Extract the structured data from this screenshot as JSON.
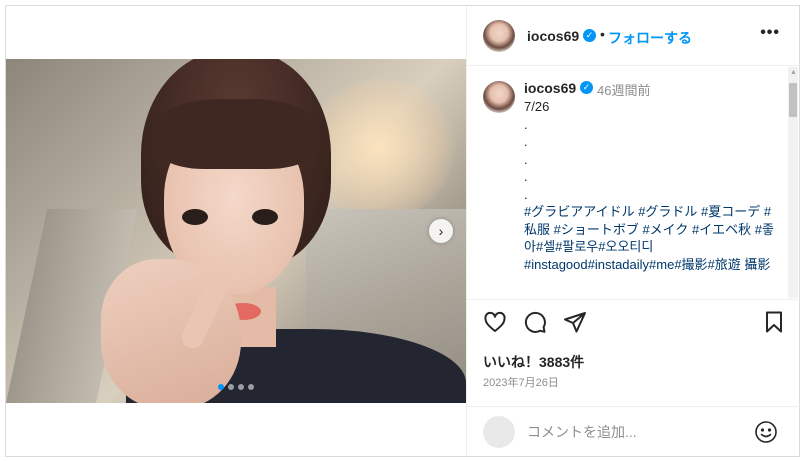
{
  "post": {
    "username": "iocos69",
    "separator": "•",
    "follow_label": "フォローする",
    "more_label": "•••",
    "next_label": "›",
    "caption": {
      "time_ago": "46週間前",
      "lines": [
        "7/26",
        ".",
        ".",
        ".",
        ".",
        "."
      ],
      "hashtags": "#グラビアアイドル #グラドル #夏コーデ #私服 #ショートボブ #メイク #イエベ秋 #좋아#셀#팔로우#오오티디 #instagood#instadaily#me#撮影#旅遊 攝影"
    },
    "likes_text": "いいね！3883件",
    "date": "2023年7月26日",
    "comment_placeholder": "コメントを追加...",
    "carousel": {
      "count": 4,
      "active_index": 0
    },
    "accent_color": "#0095f6"
  }
}
